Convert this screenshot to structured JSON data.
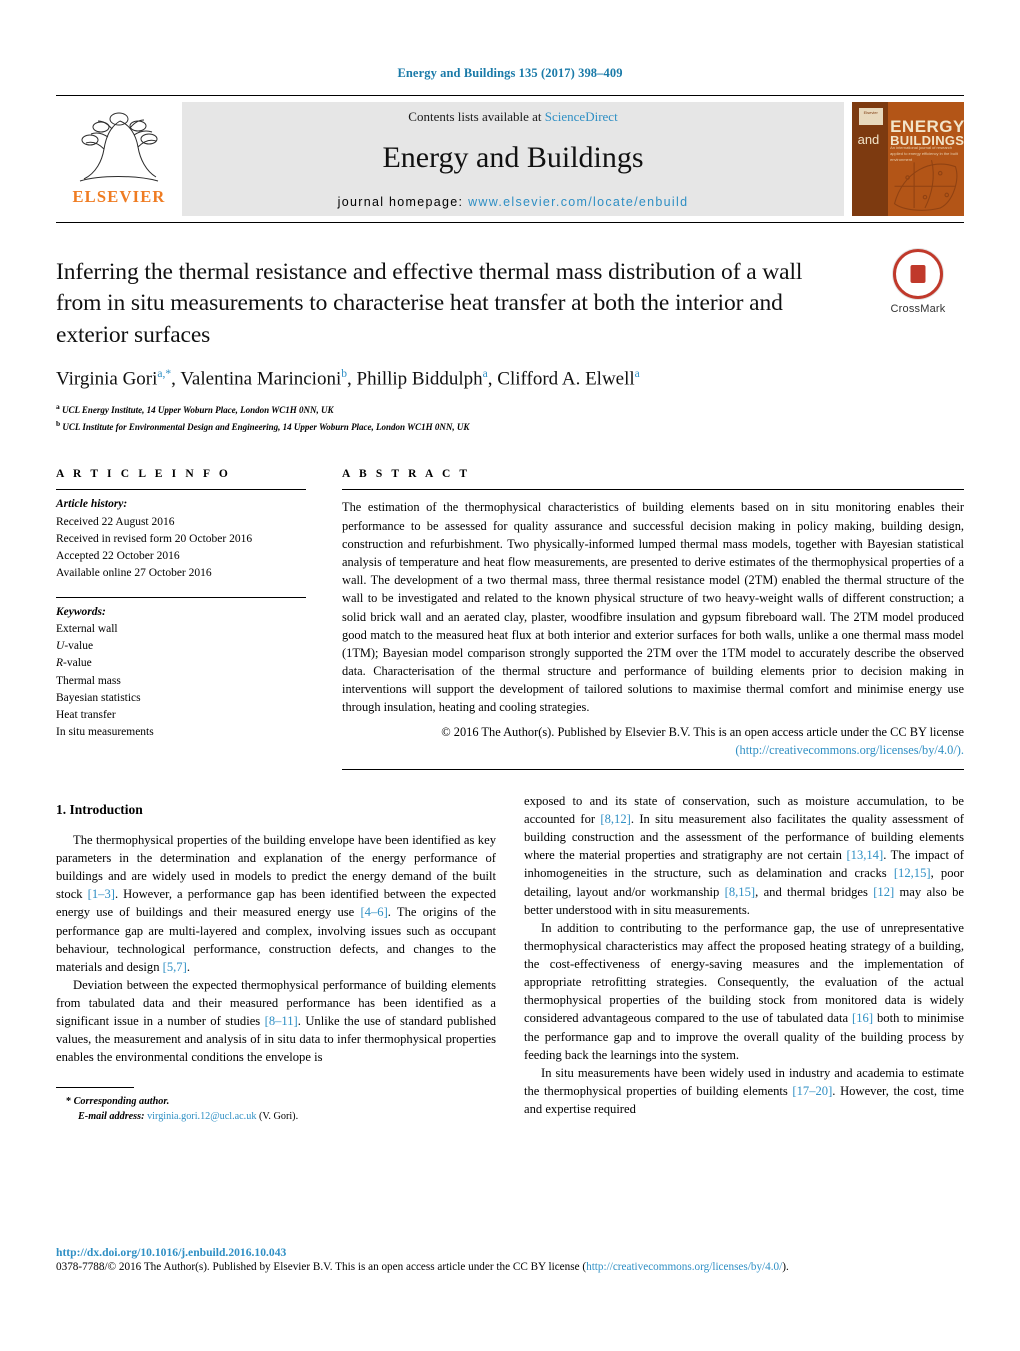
{
  "running_head": "Energy and Buildings 135 (2017) 398–409",
  "masthead": {
    "publisher_logo_name": "ELSEVIER",
    "contents_prefix": "Contents lists available at ",
    "contents_link": "ScienceDirect",
    "journal_title": "Energy and Buildings",
    "homepage_prefix": "journal homepage: ",
    "homepage_url": "www.elsevier.com/locate/enbuild",
    "cover": {
      "badge": "Elsevier",
      "and": "and",
      "energy": "ENERGY",
      "buildings": "BUILDINGS",
      "subtitle": "An international journal of research applied to energy efficiency in the built environment"
    }
  },
  "article": {
    "title": "Inferring the thermal resistance and effective thermal mass distribution of a wall from in situ measurements to characterise heat transfer at both the interior and exterior surfaces",
    "authors_html": "Virginia Gori<sup>a,*</sup>, Valentina Marincioni<sup>b</sup>, Phillip Biddulph<sup>a</sup>, Clifford A. Elwell<sup>a</sup>",
    "affiliation_a": "UCL Energy Institute, 14 Upper Woburn Place, London WC1H 0NN, UK",
    "affiliation_b": "UCL Institute for Environmental Design and Engineering, 14 Upper Woburn Place, London WC1H 0NN, UK",
    "crossmark_label": "CrossMark"
  },
  "info": {
    "heading": "A R T I C L E   I N F O",
    "history_label": "Article history:",
    "history": [
      "Received 22 August 2016",
      "Received in revised form 20 October 2016",
      "Accepted 22 October 2016",
      "Available online 27 October 2016"
    ],
    "keywords_label": "Keywords:",
    "keywords": [
      "External wall",
      "U-value",
      "R-value",
      "Thermal mass",
      "Bayesian statistics",
      "Heat transfer",
      "In situ measurements"
    ]
  },
  "abstract": {
    "heading": "A B S T R A C T",
    "text": "The estimation of the thermophysical characteristics of building elements based on in situ monitoring enables their performance to be assessed for quality assurance and successful decision making in policy making, building design, construction and refurbishment. Two physically-informed lumped thermal mass models, together with Bayesian statistical analysis of temperature and heat flow measurements, are presented to derive estimates of the thermophysical properties of a wall. The development of a two thermal mass, three thermal resistance model (2TM) enabled the thermal structure of the wall to be investigated and related to the known physical structure of two heavy-weight walls of different construction; a solid brick wall and an aerated clay, plaster, woodfibre insulation and gypsum fibreboard wall. The 2TM model produced good match to the measured heat flux at both interior and exterior surfaces for both walls, unlike a one thermal mass model (1TM); Bayesian model comparison strongly supported the 2TM over the 1TM model to accurately describe the observed data. Characterisation of the thermal structure and performance of building elements prior to decision making in interventions will support the development of tailored solutions to maximise thermal comfort and minimise energy use through insulation, heating and cooling strategies.",
    "copyright_text": "© 2016 The Author(s). Published by Elsevier B.V. This is an open access article under the CC BY license",
    "copyright_link": "(http://creativecommons.org/licenses/by/4.0/)."
  },
  "intro": {
    "heading": "1.  Introduction",
    "left_paragraphs": [
      "The thermophysical properties of the building envelope have been identified as key parameters in the determination and explanation of the energy performance of buildings and are widely used in models to predict the energy demand of the built stock [1–3]. However, a performance gap has been identified between the expected energy use of buildings and their measured energy use [4–6]. The origins of the performance gap are multi-layered and complex, involving issues such as occupant behaviour, technological performance, construction defects, and changes to the materials and design [5,7].",
      "Deviation between the expected thermophysical performance of building elements from tabulated data and their measured performance has been identified as a significant issue in a number of studies [8–11]. Unlike the use of standard published values, the measurement and analysis of in situ data to infer thermophysical properties enables the environmental conditions the envelope is"
    ],
    "right_paragraphs": [
      "exposed to and its state of conservation, such as moisture accumulation, to be accounted for [8,12]. In situ measurement also facilitates the quality assessment of building construction and the assessment of the performance of building elements where the material properties and stratigraphy are not certain [13,14]. The impact of inhomogeneities in the structure, such as delamination and cracks [12,15], poor detailing, layout and/or workmanship [8,15], and thermal bridges [12] may also be better understood with in situ measurements.",
      "In addition to contributing to the performance gap, the use of unrepresentative thermophysical characteristics may affect the proposed heating strategy of a building, the cost-effectiveness of energy-saving measures and the implementation of appropriate retrofitting strategies. Consequently, the evaluation of the actual thermophysical properties of the building stock from monitored data is widely considered advantageous compared to the use of tabulated data [16] both to minimise the performance gap and to improve the overall quality of the building process by feeding back the learnings into the system.",
      "In situ measurements have been widely used in industry and academia to estimate the thermophysical properties of building elements [17–20]. However, the cost, time and expertise required"
    ]
  },
  "footnote": {
    "star": "*",
    "corresponding": "Corresponding author.",
    "email_label": "E-mail address:",
    "email": "virginia.gori.12@ucl.ac.uk",
    "email_suffix": "(V. Gori)."
  },
  "footer": {
    "doi": "http://dx.doi.org/10.1016/j.enbuild.2016.10.043",
    "issn_text": "0378-7788/© 2016 The Author(s). Published by Elsevier B.V. This is an open access article under the CC BY license (",
    "issn_link": "http://creativecommons.org/licenses/by/4.0/",
    "issn_tail": ")."
  },
  "colors": {
    "link": "#2f8fc4",
    "running_head": "#1a7aa8",
    "elsevier_orange": "#ef7c22",
    "crossmark_red": "#c0392b"
  }
}
